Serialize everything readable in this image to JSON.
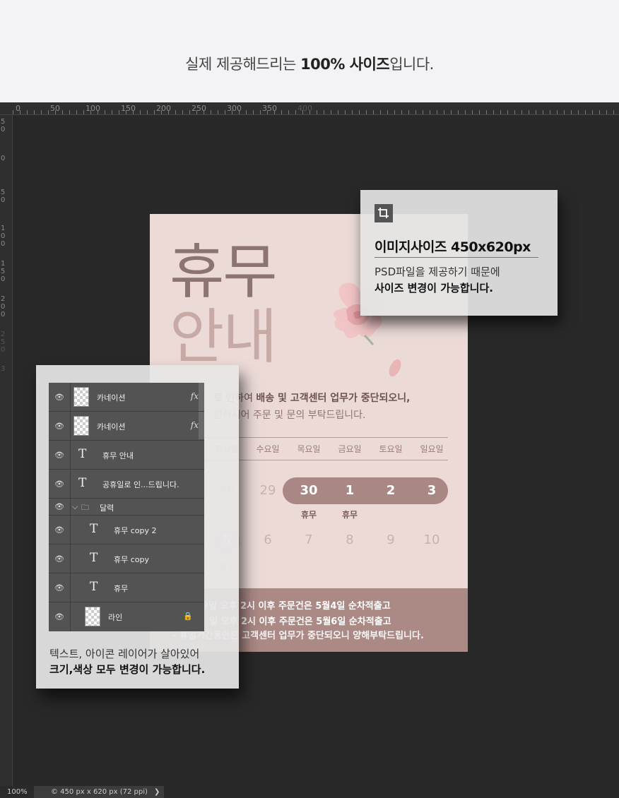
{
  "header": {
    "title_pre": "실제 제공해드리는 ",
    "title_bold": "100% 사이즈",
    "title_post": "입니다."
  },
  "ruler": {
    "top": [
      "0",
      "50",
      "100",
      "150",
      "200",
      "250",
      "300",
      "350",
      "400"
    ],
    "left": [
      "5\n0",
      "0",
      "5\n0",
      "1\n0\n0",
      "1\n5\n0",
      "2\n0\n0",
      "2\n5\n0",
      "3"
    ]
  },
  "poster": {
    "title_1": "휴무",
    "title_2": "안내",
    "notice_line1_pre": "로 인하여 ",
    "notice_line1_bold": "배송 및 고객센터 업무가 중단되오니,",
    "notice_line2": "인하시어 주문 및 문의 부탁드립니다.",
    "days": [
      "화요일",
      "수요일",
      "목요일",
      "금요일",
      "토요일",
      "일요일"
    ],
    "week1": [
      "28",
      "29",
      "30",
      "1",
      "2",
      "3"
    ],
    "week2": [
      "5",
      "6",
      "7",
      "8",
      "9",
      "10"
    ],
    "holiday_label": "휴무",
    "footer_lines": [
      "9일 오후 2시 이후 주문건은 5월4일 순차적출고",
      "일 오후 2시 이후 주문건은 5월6일 순차적출고",
      "- 휴일기간동안은 고객센터 업무가 중단되오니 양해부탁드립니다."
    ]
  },
  "info_card": {
    "crop_icon": "crop-icon",
    "title": "이미지사이즈 450x620px",
    "line1": "PSD파일을 제공하기 때문에",
    "line2": "사이즈 변경이 가능합니다."
  },
  "layers": {
    "rows": [
      {
        "name": "카네이션",
        "kind": "image",
        "fx": "fx"
      },
      {
        "name": "카네이션",
        "kind": "image",
        "fx": "fx"
      },
      {
        "name": "휴무 안내",
        "kind": "text"
      },
      {
        "name": "공휴일로 인...드립니다.",
        "kind": "text"
      },
      {
        "name": "달력",
        "kind": "folder"
      },
      {
        "name": "휴무 copy 2",
        "kind": "text"
      },
      {
        "name": "휴무 copy",
        "kind": "text"
      },
      {
        "name": "휴무",
        "kind": "text"
      },
      {
        "name": "라인",
        "kind": "image-locked"
      }
    ],
    "text_icon": "T",
    "caption_1": "텍스트, 아이콘 레이어가 살아있어",
    "caption_2": "크기,색상 모두 변경이 가능합니다."
  },
  "status": {
    "zoom": "100%",
    "doc": "© 450 px x 620 px (72 ppi)",
    "arrow": "❯"
  },
  "colors": {
    "poster_bg": "#ecdad7",
    "accent": "#a98784",
    "workspace": "#282828"
  }
}
